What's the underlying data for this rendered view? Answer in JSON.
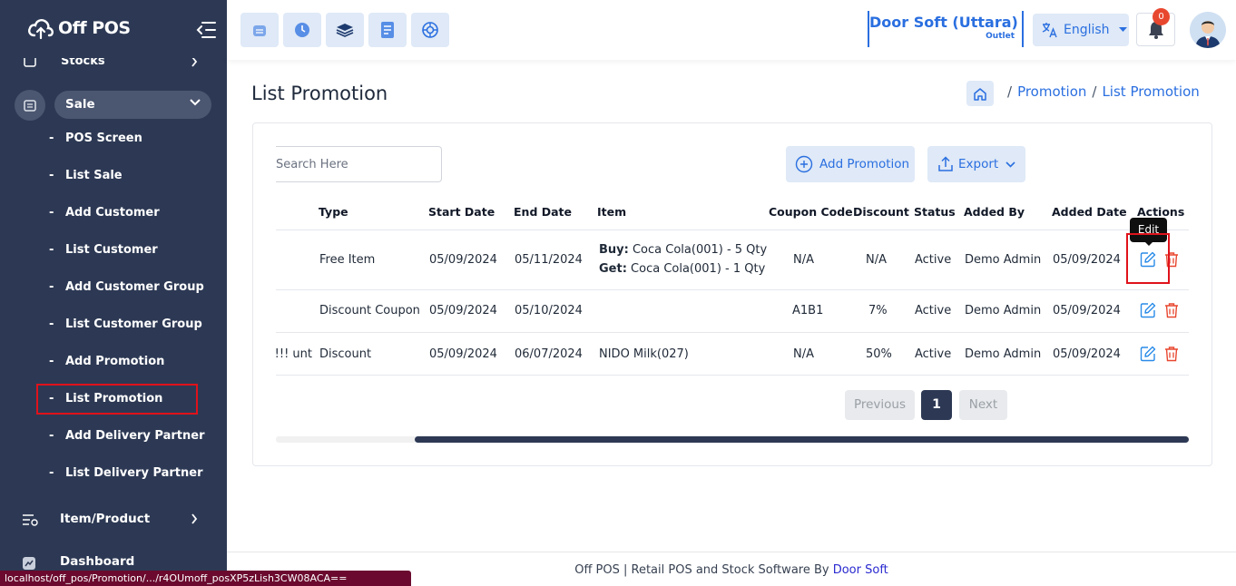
{
  "brand": {
    "name": "Off POS"
  },
  "sidebar": {
    "cut_item": "Stocks",
    "section": {
      "label": "Sale"
    },
    "sub_items": [
      {
        "label": "POS Screen"
      },
      {
        "label": "List Sale"
      },
      {
        "label": "Add Customer"
      },
      {
        "label": "List Customer"
      },
      {
        "label": "Add Customer Group"
      },
      {
        "label": "List Customer Group"
      },
      {
        "label": "Add Promotion"
      },
      {
        "label": "List Promotion"
      },
      {
        "label": "Add Delivery Partner"
      },
      {
        "label": "List Delivery Partner"
      }
    ],
    "active_item": "List Promotion",
    "menu": [
      {
        "label": "Item/Product",
        "icon": "item-product-icon"
      },
      {
        "label": "Dashboard",
        "icon": "dashboard-icon"
      }
    ]
  },
  "topbar": {
    "outlet_name": "Door Soft (Uttara)",
    "outlet_type": "Outlet",
    "language": "English",
    "notification_count": "0"
  },
  "page": {
    "title": "List Promotion",
    "breadcrumb": [
      "Promotion",
      "List Promotion"
    ]
  },
  "toolbar": {
    "search_placeholder": "Search Here",
    "add_label": "Add Promotion",
    "export_label": "Export"
  },
  "table": {
    "headers": [
      "Type",
      "Start Date",
      "End Date",
      "Item",
      "Coupon Code",
      "Discount",
      "Status",
      "Added By",
      "Added Date",
      "Actions"
    ],
    "rows": [
      {
        "title": "",
        "type": "Free Item",
        "start": "05/09/2024",
        "end": "05/11/2024",
        "item_buy_label": "Buy:",
        "item_buy": "Coca Cola(001) - 5 Qty",
        "item_get_label": "Get:",
        "item_get": "Coca Cola(001) - 1 Qty",
        "coupon": "N/A",
        "discount": "N/A",
        "status": "Active",
        "added_by": "Demo Admin",
        "added_date": "05/09/2024"
      },
      {
        "title": "",
        "type": "Discount Coupon",
        "start": "05/09/2024",
        "end": "05/10/2024",
        "item": "",
        "coupon": "A1B1",
        "discount": "7%",
        "status": "Active",
        "added_by": "Demo Admin",
        "added_date": "05/09/2024"
      },
      {
        "title": "unt !!!",
        "type": "Discount",
        "start": "05/09/2024",
        "end": "06/07/2024",
        "item": "NIDO Milk(027)",
        "coupon": "N/A",
        "discount": "50%",
        "status": "Active",
        "added_by": "Demo Admin",
        "added_date": "05/09/2024"
      }
    ],
    "tooltip": "Edit"
  },
  "pagination": {
    "prev": "Previous",
    "current": "1",
    "next": "Next"
  },
  "footer": {
    "text": "Off POS | Retail POS and Stock Software By ",
    "link": "Door Soft"
  },
  "statusbar": {
    "url": "localhost/off_pos/Promotion/.../r4OUmoff_posXP5zLish3CW08ACA=="
  },
  "colors": {
    "sidebar": "#2d3954",
    "accent": "#2a6fe0",
    "danger": "#e8472f",
    "highlight": "#e0121b"
  }
}
